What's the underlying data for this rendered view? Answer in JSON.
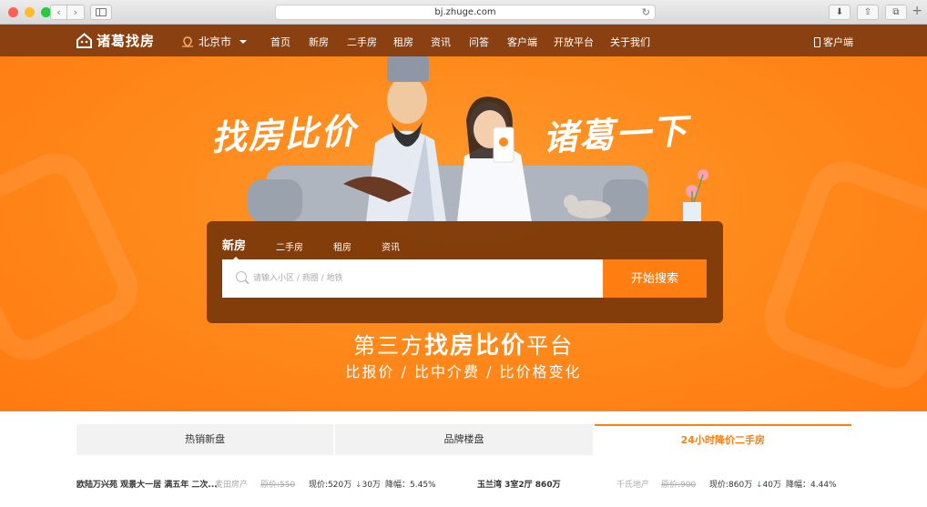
{
  "browser": {
    "url": "bj.zhuge.com",
    "colors": {
      "close": "#ff5f57",
      "minimize": "#febc2e",
      "zoom": "#28c840"
    }
  },
  "header": {
    "logo_text": "诸葛找房",
    "city": "北京市",
    "nav": [
      "首页",
      "新房",
      "二手房",
      "租房",
      "资讯",
      "问答",
      "客户端",
      "开放平台",
      "关于我们"
    ],
    "client_label": "客户端"
  },
  "hero": {
    "slogan_left": "找房比价",
    "slogan_right": "诸葛一下",
    "search_tabs": [
      "新房",
      "二手房",
      "租房",
      "资讯"
    ],
    "active_tab": "新房",
    "search_placeholder": "请输入小区 / 商圈 / 地铁",
    "search_button": "开始搜索",
    "tagline_prefix": "第三方",
    "tagline_bold": "找房比价",
    "tagline_suffix": "平台",
    "tagline_sub": "比报价 / 比中介费 / 比价格变化"
  },
  "sections": {
    "tabs": [
      "热销新盘",
      "品牌楼盘",
      "24小时降价二手房"
    ],
    "active": "24小时降价二手房"
  },
  "listings": [
    {
      "title": "欧陆万兴苑 观景大一居 满五年 二次...",
      "agency": "麦田房产",
      "orig_price": "原价:550",
      "now_price": "现价:520万",
      "drop": "30万",
      "drop_rate": "降幅：5.45%"
    },
    {
      "title": "玉兰湾 3室2厅 860万",
      "agency": "千氏地产",
      "orig_price": "原价:900",
      "now_price": "现价:860万",
      "drop": "40万",
      "drop_rate": "降幅：4.44%"
    }
  ],
  "accent_color": "#ff7e12"
}
